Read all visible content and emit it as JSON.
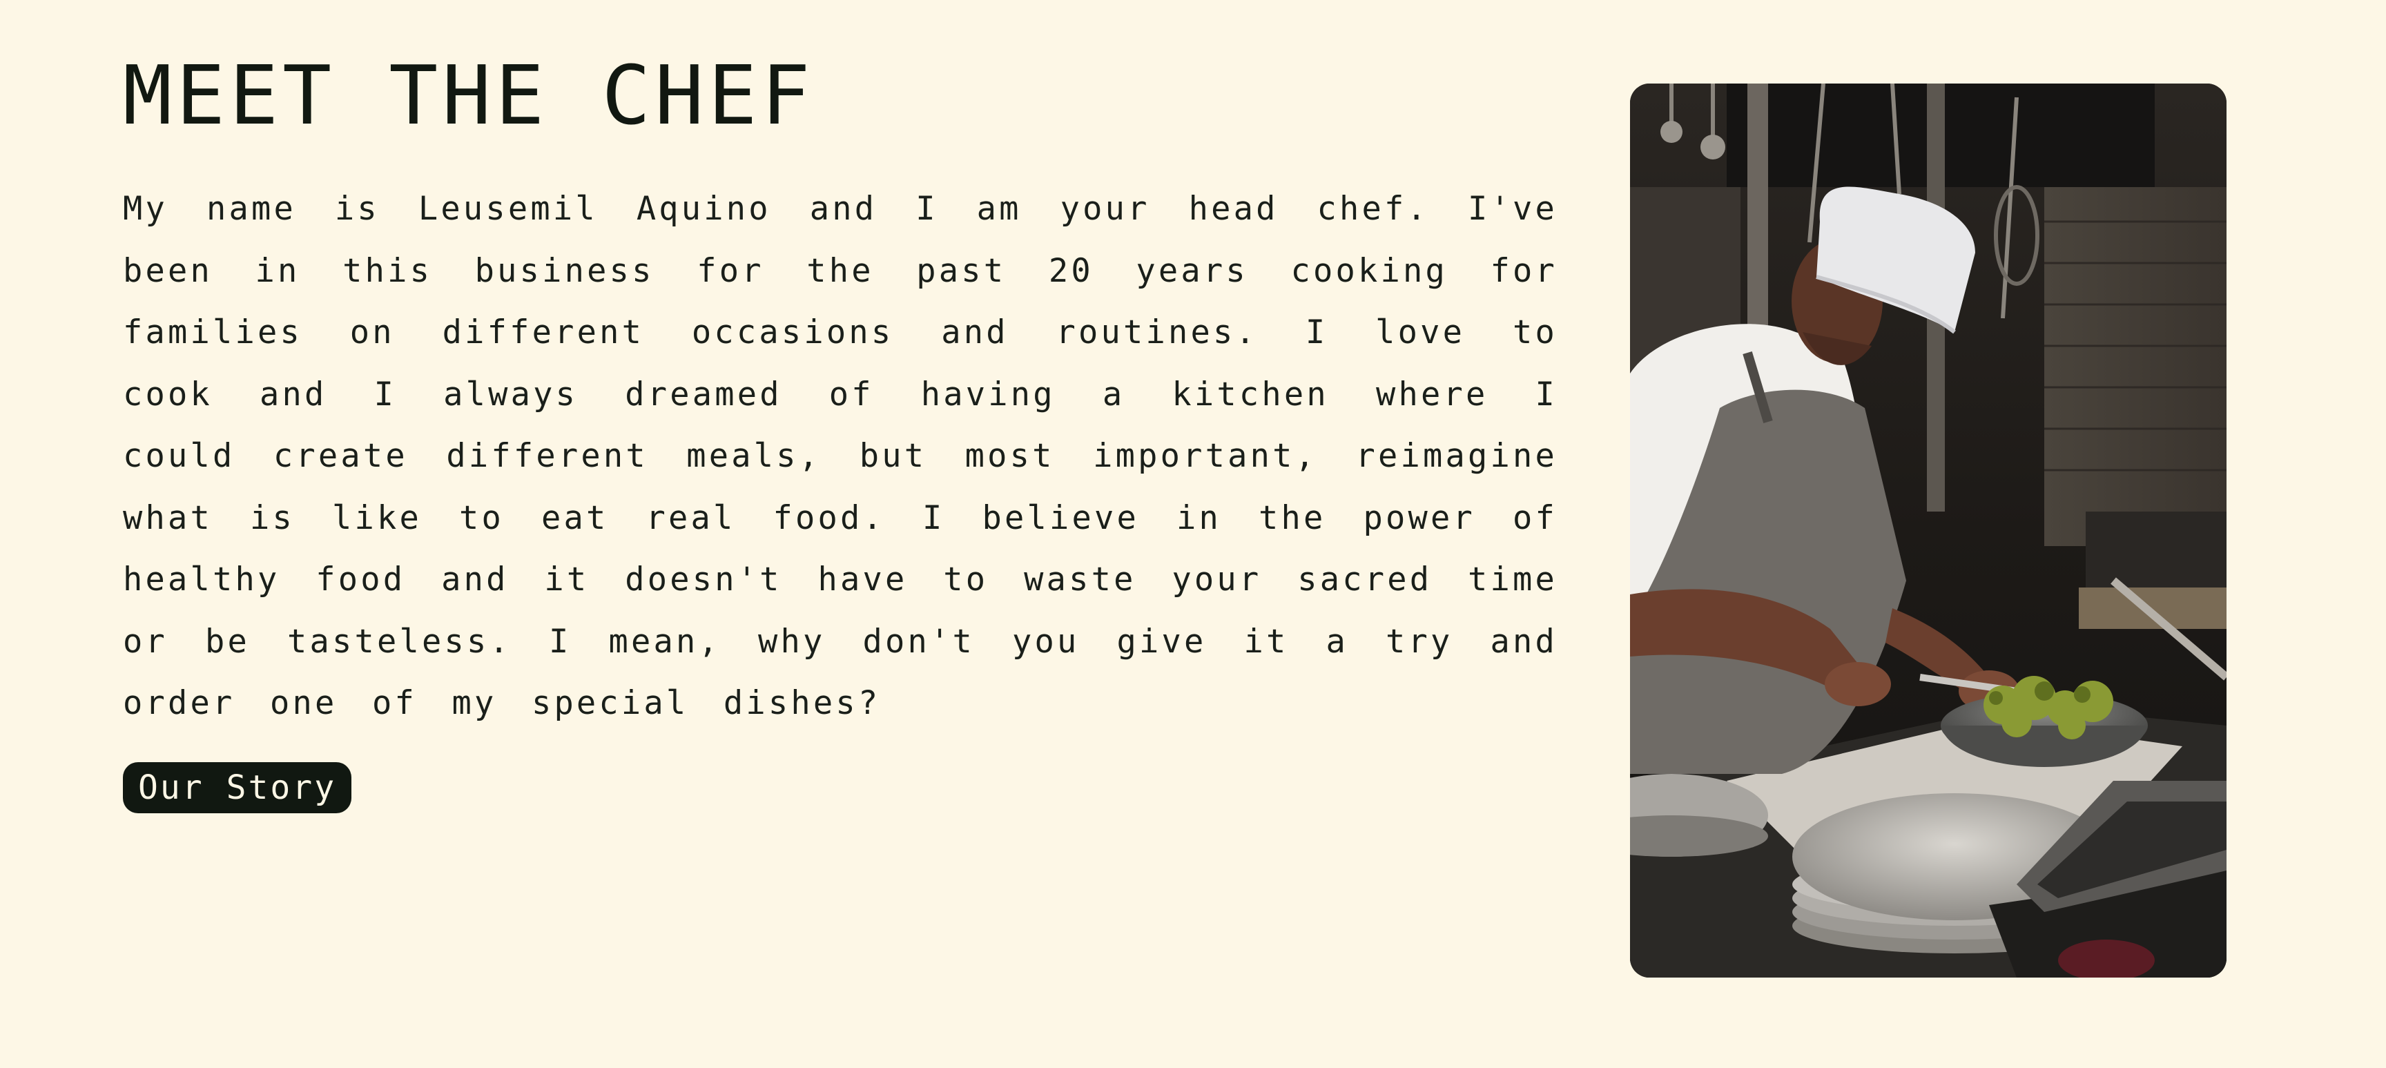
{
  "section": {
    "title": "MEET THE CHEF",
    "bio": "My name is Leusemil Aquino and I am your head chef. I've been in this business for the past 20 years cooking for families on different occasions and routines. I love to cook and I always dreamed of having a kitchen where I could create different meals, but most important, reimagine what is like to eat real food. I believe in the power of healthy food and it doesn't have to waste your sacred time or be tasteless. I mean, why don't you give it a try and order one of my special dishes?",
    "button_label": "Our Story"
  },
  "photo": {
    "subject": "chef-cutting-vegetables-photo"
  },
  "colors": {
    "background": "#fdf7e6",
    "text": "#111811",
    "button_bg": "#111811",
    "button_text": "#fdf7e6"
  }
}
